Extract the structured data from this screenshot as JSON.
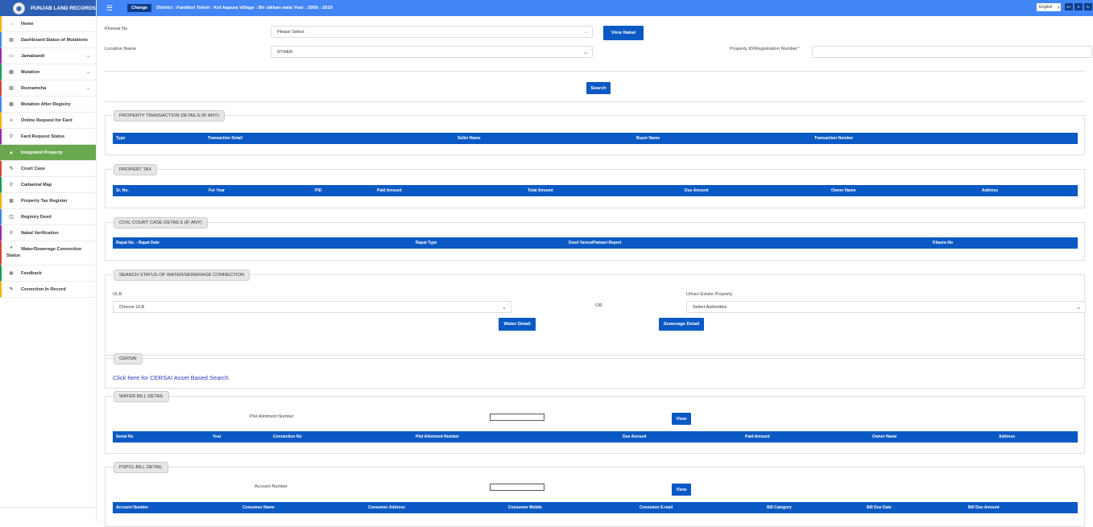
{
  "brand": {
    "title": "PUNJAB LAND RECORDS"
  },
  "topbar": {
    "change_label": "Change",
    "location": "District :  Faridkot  Tehsil :  Kot kapura  Village :  Bir sikhan wala  Year :  2009 - 2010",
    "language": "English",
    "font_buttons": [
      "A+",
      "A",
      "A-"
    ]
  },
  "sidebar": {
    "items": [
      {
        "label": "Home",
        "icon": "home-icon"
      },
      {
        "label": "Dashboard-Status of Mutations",
        "icon": "dashboard-icon"
      },
      {
        "label": "Jamabandi",
        "icon": "book-icon",
        "expand": true
      },
      {
        "label": "Mutation",
        "icon": "document-icon",
        "expand": true
      },
      {
        "label": "Roznamcha",
        "icon": "journal-icon",
        "expand": true
      },
      {
        "label": "Mutation After Registry",
        "icon": "registry-icon"
      },
      {
        "label": "Online Request for Fard",
        "icon": "request-icon"
      },
      {
        "label": "Fard Request Status",
        "icon": "search-icon"
      },
      {
        "label": "Integrated Property",
        "icon": "building-icon",
        "active": true
      },
      {
        "label": "Court Case",
        "icon": "gavel-icon"
      },
      {
        "label": "Cadastral Map",
        "icon": "map-pin-icon"
      },
      {
        "label": "Property Tax Register",
        "icon": "register-icon"
      },
      {
        "label": "Registry Deed",
        "icon": "deed-icon"
      },
      {
        "label": "Nakal Verification",
        "icon": "verify-icon"
      },
      {
        "label": "Water/Sewerage Connection",
        "label2": "Status",
        "icon": "water-drop-icon"
      },
      {
        "label": "Feedback",
        "icon": "feedback-icon"
      },
      {
        "label": "Correction In Record",
        "icon": "edit-icon"
      }
    ]
  },
  "form": {
    "khewat_label": "Khewat No",
    "khewat_value": "Please Select",
    "view_nakal": "View Nakal",
    "location_label": "Location Name",
    "location_value": "OTHER",
    "property_id_label": "Property ID/Registration Number",
    "required_mark": "*",
    "property_id_value": "",
    "search": "Search"
  },
  "sections": {
    "transaction": {
      "title": "PROPERTY TRANSACTION DETAILS (IF ANY)",
      "columns": [
        "Type",
        "Transaction Detail",
        "Seller Name",
        "Buyer Name",
        "Transaction Number"
      ]
    },
    "tax": {
      "title": "PROPERT TAX",
      "columns": [
        "Sr. No.",
        "For Year",
        "PID",
        "Paid Amount",
        "Total Amount",
        "Due Amount",
        "Owner Name",
        "Address"
      ]
    },
    "court": {
      "title": "CIVIL COURT CASE DETAILS (IF ANY)",
      "columns": [
        "Rapat No. - Rapat Date",
        "Rapat Type",
        "Deed Varvra/Patwari Report",
        "Khasra No"
      ]
    },
    "water_status": {
      "title": "SEARCH STATUS OF WATER/SEWERAGE CONNECTION",
      "ulb_label": "ULB",
      "ulb_value": "Choose ULB",
      "or_label": "OR",
      "urban_label": "Urban Estate Property",
      "urban_value": "Select Authorities",
      "water_btn": "Water Detail",
      "sewerage_btn": "Sewerage Detail"
    },
    "cersai": {
      "title": "CERSAI",
      "link": "Click here for CERSAI Asset Based Search"
    },
    "water_bill": {
      "title": "WATER BILL DETAIL",
      "input_label": "Plot Allotment Number",
      "view": "View",
      "columns": [
        "Serial No",
        "Year",
        "Connection No",
        "Plot Allotment Number",
        "Due Amount",
        "Paid Amount",
        "Owner Name",
        "Address"
      ]
    },
    "pspcl": {
      "title": "PSPCL BILL DETAIL",
      "input_label": "Account Number",
      "view": "View",
      "columns": [
        "Account Number",
        "Consumer Name",
        "Consumer Address",
        "Consumer Mobile",
        "Consumer E-mail",
        "Bill Category",
        "Bill Due Date",
        "Bill Due Amount"
      ]
    }
  },
  "colors": {
    "primary": "#0b59c4",
    "topbar": "#4285f4",
    "brand": "#2d5fb5",
    "active": "#6aa84f"
  }
}
